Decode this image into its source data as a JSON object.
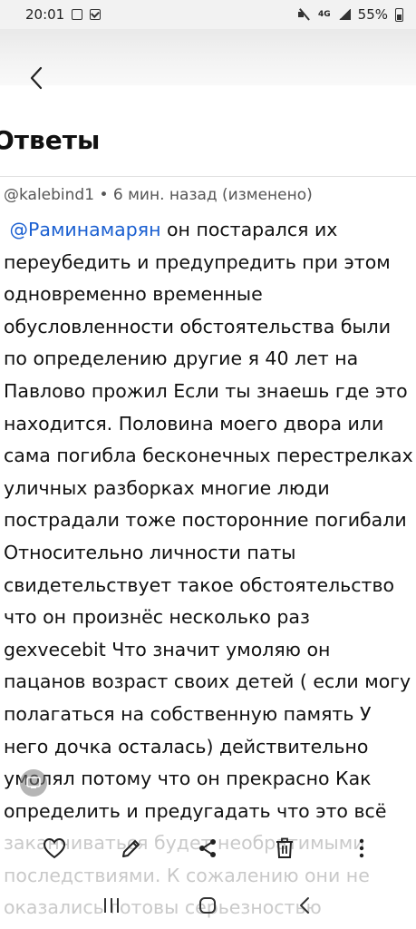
{
  "status_bar": {
    "time": "20:01",
    "network": "4G",
    "battery": "55%"
  },
  "header": {
    "back_icon": "chevron-left-icon"
  },
  "section": {
    "title": "Ответы"
  },
  "comment": {
    "author": "@kalebind1",
    "separator": " • ",
    "time": "6 мин. назад (изменено)",
    "mention": "@Раминамарян",
    "lines": [
      " он постарался их",
      "переубедить и предупредить при этом",
      "одновременно временные",
      "обусловленности обстоятельства были",
      "по определению другие я 40 лет на",
      "Павлово прожил Если ты знаешь где это",
      "находится. Половина моего двора или",
      "сама погибла бесконечных перестрелках",
      "уличных разборках многие люди",
      "пострадали тоже посторонние погибали",
      "Относительно личности паты",
      "свидетельствует такое обстоятельство",
      "что он произнёс несколько раз",
      "gexvecebit Что значит умоляю он",
      "пацанов возраст своих детей ( если могу",
      "полагаться на собственную память У",
      "него дочка осталась) действительно",
      "умолял потому что он прекрасно Как",
      "определить и предугадать что это всё",
      "заканчиваться будет необратимыми",
      "последствиями. К сожалению они не",
      "оказались готовы серьезностью"
    ]
  },
  "actions": {
    "like_icon": "heart-icon",
    "edit_icon": "pencil-icon",
    "share_icon": "share-icon",
    "delete_icon": "trash-icon",
    "more_icon": "more-vertical-icon"
  },
  "nav": {
    "recents_icon": "recents-icon",
    "home_icon": "home-icon",
    "back_icon": "back-icon"
  },
  "colors": {
    "mention": "#1a5fd1",
    "text": "#111111",
    "meta": "#555555"
  }
}
